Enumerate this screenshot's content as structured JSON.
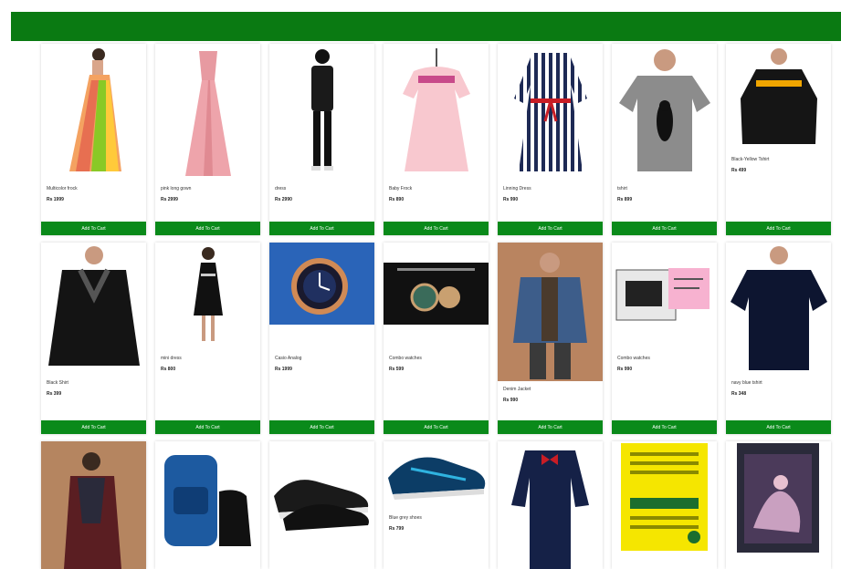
{
  "header": {
    "color": "#0a7a12"
  },
  "accent": "#0a8a1a",
  "add_to_cart_label": "Add To Cart",
  "products": [
    {
      "name": "Multicolor frock",
      "price": "Rs 1999",
      "icon": "rainbow-dress-icon"
    },
    {
      "name": "pink long gown",
      "price": "Rs 2999",
      "icon": "pink-gown-icon"
    },
    {
      "name": "dress",
      "price": "Rs 2990",
      "icon": "black-outfit-icon"
    },
    {
      "name": "Baby Frock",
      "price": "Rs 890",
      "icon": "baby-frock-icon"
    },
    {
      "name": "Linning Dress",
      "price": "Rs 990",
      "icon": "striped-dress-icon"
    },
    {
      "name": "tshirt",
      "price": "Rs 899",
      "icon": "grey-tshirt-icon"
    },
    {
      "name": "Black-Yellow Tshirt",
      "price": "Rs 499",
      "icon": "hoodie-icon"
    },
    {
      "name": "Black Shirt",
      "price": "Rs 399",
      "icon": "black-shirt-icon"
    },
    {
      "name": "mini dress",
      "price": "Rs 800",
      "icon": "mini-dress-icon"
    },
    {
      "name": "Casio Analog",
      "price": "Rs 1999",
      "icon": "watch-icon"
    },
    {
      "name": "Combo watches",
      "price": "Rs 599",
      "icon": "combo-watch-icon"
    },
    {
      "name": "Denim Jacket",
      "price": "Rs 990",
      "icon": "denim-jacket-icon"
    },
    {
      "name": "Combo watches",
      "price": "Rs 990",
      "icon": "watch-box-icon"
    },
    {
      "name": "navy blue tshirt",
      "price": "Rs 348",
      "icon": "navy-tshirt-icon"
    },
    {
      "name": "",
      "price": "",
      "icon": "ethnic-outfit-icon"
    },
    {
      "name": "",
      "price": "",
      "icon": "backpack-icon"
    },
    {
      "name": "",
      "price": "",
      "icon": "black-shoes-icon"
    },
    {
      "name": "Blue grey shoes",
      "price": "Rs 799",
      "icon": "blue-shoes-icon"
    },
    {
      "name": "",
      "price": "",
      "icon": "kids-suit-icon"
    },
    {
      "name": "",
      "price": "",
      "icon": "scratch-book-icon"
    },
    {
      "name": "",
      "price": "",
      "icon": "dragon-book-icon"
    }
  ]
}
